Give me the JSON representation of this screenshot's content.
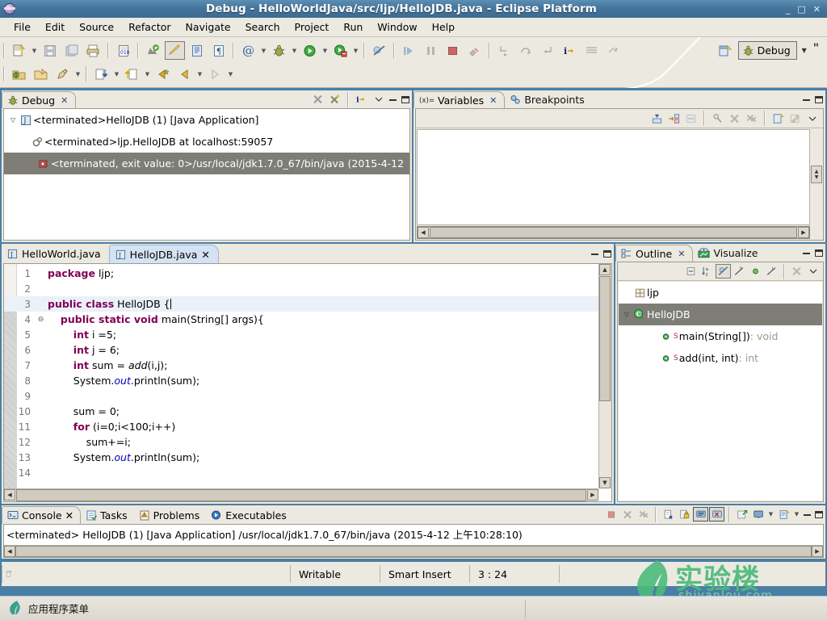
{
  "window": {
    "title": "Debug - HelloWorldJava/src/ljp/HelloJDB.java - Eclipse Platform",
    "minimize": "_",
    "maximize": "□",
    "close": "✕"
  },
  "menubar": {
    "items": [
      {
        "label": "File"
      },
      {
        "label": "Edit"
      },
      {
        "label": "Source"
      },
      {
        "label": "Refactor"
      },
      {
        "label": "Navigate"
      },
      {
        "label": "Search"
      },
      {
        "label": "Project"
      },
      {
        "label": "Run"
      },
      {
        "label": "Window"
      },
      {
        "label": "Help"
      }
    ]
  },
  "toolbar": {
    "perspective": {
      "open_label": "open-perspective",
      "active_label": "Debug",
      "dropdown": "▼",
      "quote": "\""
    }
  },
  "debug_view": {
    "tab_label": "Debug",
    "close": "✕",
    "tree": [
      {
        "label": "<terminated>HelloJDB (1) [Java Application]",
        "indent": 0,
        "twisty": "▽",
        "icon": "java-launch-icon",
        "selected": false
      },
      {
        "label": "<terminated>ljp.HelloJDB at localhost:59057",
        "indent": 1,
        "twisty": "",
        "icon": "debug-target-icon",
        "selected": false
      },
      {
        "label": "<terminated, exit value: 0>/usr/local/jdk1.7.0_67/bin/java (2015-4-12",
        "indent": 2,
        "twisty": "",
        "icon": "process-icon",
        "selected": true
      }
    ]
  },
  "variables_view": {
    "tabs": [
      {
        "label": "Variables",
        "active": true,
        "icon": "variables-icon",
        "close": "✕"
      },
      {
        "label": "Breakpoints",
        "active": false,
        "icon": "breakpoints-icon",
        "close": ""
      }
    ]
  },
  "editor": {
    "tabs": [
      {
        "label": "HelloWorld.java",
        "active": false,
        "icon": "java-file-icon",
        "close": ""
      },
      {
        "label": "HelloJDB.java",
        "active": true,
        "icon": "java-file-icon",
        "close": "✕"
      }
    ],
    "lines": [
      {
        "n": "1",
        "fold": "",
        "highlight": false,
        "tokens": [
          {
            "t": "package",
            "c": "kw"
          },
          {
            "t": " ljp;",
            "c": ""
          }
        ]
      },
      {
        "n": "2",
        "fold": "",
        "highlight": false,
        "tokens": [
          {
            "t": "",
            "c": ""
          }
        ]
      },
      {
        "n": "3",
        "fold": "",
        "highlight": true,
        "tokens": [
          {
            "t": "public class",
            "c": "kw"
          },
          {
            "t": " HelloJDB {",
            "c": ""
          }
        ]
      },
      {
        "n": "4",
        "fold": "⊖",
        "highlight": false,
        "tokens": [
          {
            "t": "    ",
            "c": ""
          },
          {
            "t": "public static void",
            "c": "kw"
          },
          {
            "t": " main(String[] args){",
            "c": ""
          }
        ]
      },
      {
        "n": "5",
        "fold": "",
        "highlight": false,
        "tokens": [
          {
            "t": "        ",
            "c": ""
          },
          {
            "t": "int",
            "c": "kw"
          },
          {
            "t": " i =5;",
            "c": ""
          }
        ]
      },
      {
        "n": "6",
        "fold": "",
        "highlight": false,
        "tokens": [
          {
            "t": "        ",
            "c": ""
          },
          {
            "t": "int",
            "c": "kw"
          },
          {
            "t": " j = 6;",
            "c": ""
          }
        ]
      },
      {
        "n": "7",
        "fold": "",
        "highlight": false,
        "tokens": [
          {
            "t": "        ",
            "c": ""
          },
          {
            "t": "int",
            "c": "kw"
          },
          {
            "t": " sum = ",
            "c": ""
          },
          {
            "t": "add",
            "c": "mth"
          },
          {
            "t": "(i,j);",
            "c": ""
          }
        ]
      },
      {
        "n": "8",
        "fold": "",
        "highlight": false,
        "tokens": [
          {
            "t": "        System.",
            "c": ""
          },
          {
            "t": "out",
            "c": "fld"
          },
          {
            "t": ".println(sum);",
            "c": ""
          }
        ]
      },
      {
        "n": "9",
        "fold": "",
        "highlight": false,
        "tokens": [
          {
            "t": "",
            "c": ""
          }
        ]
      },
      {
        "n": "10",
        "fold": "",
        "highlight": false,
        "tokens": [
          {
            "t": "        sum = 0;",
            "c": ""
          }
        ]
      },
      {
        "n": "11",
        "fold": "",
        "highlight": false,
        "tokens": [
          {
            "t": "        ",
            "c": ""
          },
          {
            "t": "for",
            "c": "kw"
          },
          {
            "t": " (i=0;i<100;i++)",
            "c": ""
          }
        ]
      },
      {
        "n": "12",
        "fold": "",
        "highlight": false,
        "tokens": [
          {
            "t": "            sum+=i;",
            "c": ""
          }
        ]
      },
      {
        "n": "13",
        "fold": "",
        "highlight": false,
        "tokens": [
          {
            "t": "        System.",
            "c": ""
          },
          {
            "t": "out",
            "c": "fld"
          },
          {
            "t": ".println(sum);",
            "c": ""
          }
        ]
      },
      {
        "n": "14",
        "fold": "",
        "highlight": false,
        "tokens": [
          {
            "t": "",
            "c": ""
          }
        ]
      }
    ]
  },
  "outline_view": {
    "tabs": [
      {
        "label": "Outline",
        "active": true,
        "icon": "outline-icon",
        "close": "✕"
      },
      {
        "label": "Visualize",
        "active": false,
        "icon": "visualize-icon",
        "close": ""
      }
    ],
    "rows": [
      {
        "label": "ljp",
        "type": "package",
        "indent": 0,
        "twisty": "",
        "selected": false,
        "ret": ""
      },
      {
        "label": "HelloJDB",
        "type": "class",
        "indent": 0,
        "twisty": "▽",
        "selected": true,
        "ret": ""
      },
      {
        "label": "main(String[])",
        "type": "method",
        "indent": 1,
        "twisty": "",
        "selected": false,
        "ret": " : void"
      },
      {
        "label": "add(int, int)",
        "type": "method",
        "indent": 1,
        "twisty": "",
        "selected": false,
        "ret": " : int"
      }
    ]
  },
  "console_view": {
    "tabs": [
      {
        "label": "Console",
        "active": true,
        "icon": "console-icon",
        "close": "✕"
      },
      {
        "label": "Tasks",
        "active": false,
        "icon": "tasks-icon",
        "close": ""
      },
      {
        "label": "Problems",
        "active": false,
        "icon": "problems-icon",
        "close": ""
      },
      {
        "label": "Executables",
        "active": false,
        "icon": "executables-icon",
        "close": ""
      }
    ],
    "output": "<terminated> HelloJDB (1) [Java Application] /usr/local/jdk1.7.0_67/bin/java (2015-4-12 上午10:28:10)"
  },
  "statusbar": {
    "writable": "Writable",
    "insert_mode": "Smart Insert",
    "position": "3 : 24"
  },
  "watermark": {
    "cn": "实验楼",
    "en": "shiyanlou.com",
    "color": "#4cba7b"
  },
  "taskbar": {
    "app_menu": "应用程序菜单"
  },
  "colors": {
    "titlebar": "#46759b",
    "chrome": "#ece9e1",
    "selection": "#7e7e76",
    "keyword": "#7f0055",
    "field": "#0000c0",
    "current_line": "#eaf1f9",
    "active_tab": "#d4e3f3"
  }
}
